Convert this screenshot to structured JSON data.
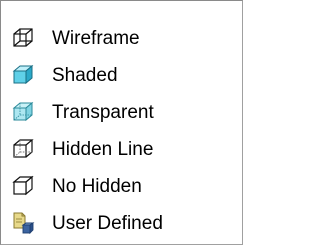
{
  "menu": {
    "items": [
      {
        "label": "Wireframe",
        "icon": "wireframe-cube-icon"
      },
      {
        "label": "Shaded",
        "icon": "shaded-cube-icon"
      },
      {
        "label": "Transparent",
        "icon": "transparent-cube-icon"
      },
      {
        "label": "Hidden Line",
        "icon": "hidden-line-cube-icon"
      },
      {
        "label": "No Hidden",
        "icon": "no-hidden-cube-icon"
      },
      {
        "label": "User Defined",
        "icon": "user-defined-icon"
      }
    ]
  },
  "colors": {
    "border": "#8a8a8a",
    "shaded_front": "#5fd0e8",
    "shaded_top": "#bff0fa",
    "shaded_side": "#2aa8c8",
    "transparent_fill": "#9fe3ee",
    "user_defined_doc": "#e8d98a",
    "user_defined_cube": "#3c64a0"
  }
}
